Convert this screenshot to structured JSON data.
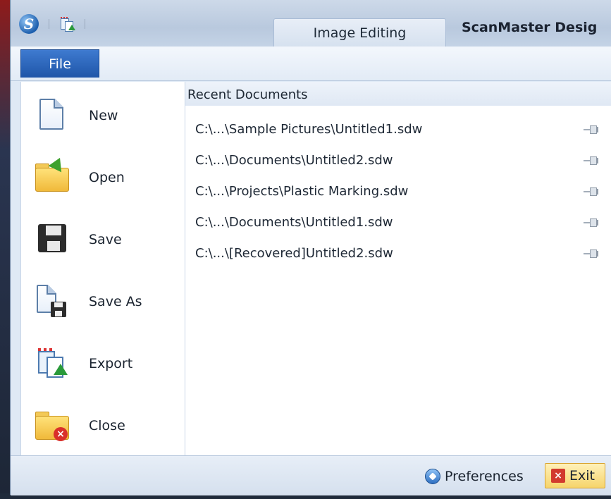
{
  "titlebar": {
    "active_tab": "Image Editing",
    "app_title": "ScanMaster Desig"
  },
  "file_tab": {
    "label": "File"
  },
  "menu": {
    "items": [
      {
        "label": "New",
        "icon": "new-document-icon"
      },
      {
        "label": "Open",
        "icon": "open-folder-icon"
      },
      {
        "label": "Save",
        "icon": "save-floppy-icon"
      },
      {
        "label": "Save As",
        "icon": "save-as-icon"
      },
      {
        "label": "Export",
        "icon": "export-icon"
      },
      {
        "label": "Close",
        "icon": "close-folder-icon"
      }
    ]
  },
  "recent": {
    "header": "Recent Documents",
    "items": [
      {
        "path": "C:\\...\\Sample Pictures\\Untitled1.sdw",
        "icon": "pin-icon"
      },
      {
        "path": "C:\\...\\Documents\\Untitled2.sdw",
        "icon": "pin-icon"
      },
      {
        "path": "C:\\...\\Projects\\Plastic Marking.sdw",
        "icon": "pin-icon"
      },
      {
        "path": "C:\\...\\Documents\\Untitled1.sdw",
        "icon": "pin-icon"
      },
      {
        "path": "C:\\...\\[Recovered]Untitled2.sdw",
        "icon": "pin-icon"
      }
    ]
  },
  "footer": {
    "preferences_label": "Preferences",
    "exit_label": "Exit"
  },
  "colors": {
    "file_tab": "#2b63b8",
    "exit_button": "#f6d46b",
    "exit_icon": "#d23a2e"
  }
}
